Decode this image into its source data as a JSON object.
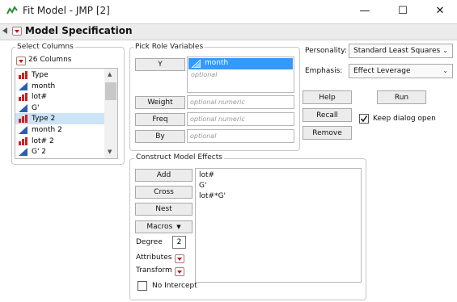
{
  "window": {
    "title": "Fit Model - JMP [2]",
    "minimize": "—",
    "maximize": "☐",
    "close": "✕"
  },
  "outline": {
    "title": "Model Specification"
  },
  "select_columns": {
    "legend": "Select Columns",
    "count_label": "26 Columns",
    "items": [
      {
        "label": "Type",
        "icon": "nominal-icon"
      },
      {
        "label": "month",
        "icon": "continuous-icon"
      },
      {
        "label": "lot#",
        "icon": "nominal-icon"
      },
      {
        "label": "G'",
        "icon": "continuous-icon"
      },
      {
        "label": "Type 2",
        "icon": "nominal-icon",
        "selected": true
      },
      {
        "label": "month 2",
        "icon": "continuous-icon"
      },
      {
        "label": "lot# 2",
        "icon": "nominal-icon"
      },
      {
        "label": "G' 2",
        "icon": "continuous-icon"
      }
    ]
  },
  "pick_role": {
    "legend": "Pick Role Variables",
    "y_button": "Y",
    "y_value": "month",
    "y_optional": "optional",
    "weight_button": "Weight",
    "weight_placeholder": "optional numeric",
    "freq_button": "Freq",
    "freq_placeholder": "optional numeric",
    "by_button": "By",
    "by_placeholder": "optional"
  },
  "settings": {
    "personality_label": "Personality:",
    "personality_value": "Standard Least Squares",
    "emphasis_label": "Emphasis:",
    "emphasis_value": "Effect Leverage"
  },
  "actions": {
    "help": "Help",
    "run": "Run",
    "recall": "Recall",
    "remove": "Remove",
    "keep_open": "Keep dialog open",
    "keep_open_checked": true
  },
  "construct": {
    "legend": "Construct Model Effects",
    "add": "Add",
    "cross": "Cross",
    "nest": "Nest",
    "macros": "Macros",
    "degree_label": "Degree",
    "degree_value": "2",
    "attributes_label": "Attributes",
    "transform_label": "Transform",
    "no_intercept": "No Intercept",
    "effects": [
      "lot#",
      "G'",
      "lot#*G'"
    ]
  },
  "colors": {
    "selection": "#3399ff",
    "list_selection": "#cce4f7",
    "nominal_icon": "#cc2222",
    "continuous_icon": "#2a5fb0"
  }
}
